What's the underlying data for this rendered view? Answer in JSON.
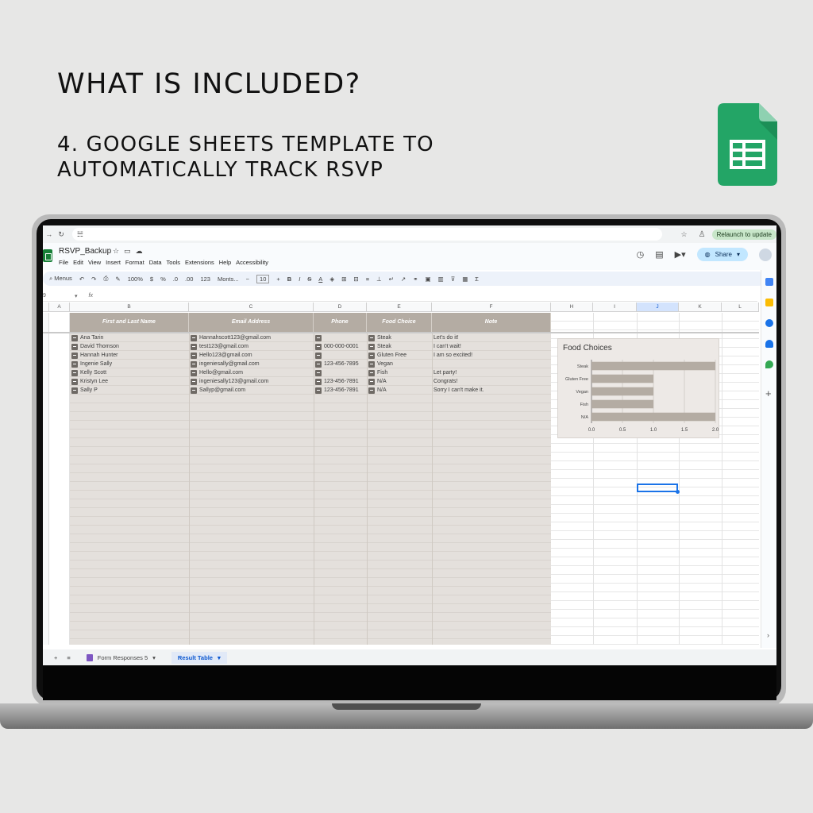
{
  "marketing": {
    "headline": "WHAT IS INCLUDED?",
    "subline1": "4. GOOGLE SHEETS TEMPLATE TO",
    "subline2": "AUTOMATICALLY TRACK RSVP"
  },
  "browser": {
    "url": "☵",
    "relaunch_label": "Relaunch to update"
  },
  "doc": {
    "title": "RSVP_Backup",
    "menus": [
      "File",
      "Edit",
      "View",
      "Insert",
      "Format",
      "Data",
      "Tools",
      "Extensions",
      "Help",
      "Accessibility"
    ],
    "share_label": "Share"
  },
  "toolbar": {
    "search": "Menus",
    "zoom": "100%",
    "currency": "$",
    "percent": "%",
    "dec_down": ".0",
    "dec_up": ".00",
    "number_format": "123",
    "font": "Monts...",
    "font_size": "10"
  },
  "formula_bar": {
    "name_box": "9",
    "fx": "fx"
  },
  "columns": [
    "A",
    "B",
    "C",
    "D",
    "E",
    "F",
    "H",
    "I",
    "J",
    "K",
    "L"
  ],
  "table": {
    "headers": [
      "First and Last Name",
      "Email Address",
      "Phone",
      "Food Choice",
      "Note"
    ],
    "rows": [
      [
        "Ana Tarin",
        "Hannahscott123@gmail.com",
        "",
        "Steak",
        "Let's do it!"
      ],
      [
        "David Thomson",
        "test123@gmail.com",
        "000-000-0001",
        "Steak",
        "I can't wait!"
      ],
      [
        "Hannah Hunter",
        "Hello123@gmail.com",
        "",
        "Gluten Free",
        "I am so excited!"
      ],
      [
        "Ingenie Sally",
        "ingeniesally@gmail.com",
        "123-456-7895",
        "Vegan",
        ""
      ],
      [
        "Kelly Scott",
        "Hello@gmail.com",
        "",
        "Fish",
        "Let party!"
      ],
      [
        "Kristyn Lee",
        "ingeniesally123@gmail.com",
        "123-456-7891",
        "N/A",
        "Congrats!"
      ],
      [
        "Sally P",
        "Sallyp@gmail.com",
        "123-456-7891",
        "N/A",
        "Sorry I can't make it."
      ]
    ]
  },
  "chart_data": {
    "type": "bar",
    "orientation": "horizontal",
    "title": "Food Choices",
    "categories": [
      "Steak",
      "Gluten Free",
      "Vegan",
      "Fish",
      "N/A"
    ],
    "values": [
      2,
      1,
      1,
      1,
      2
    ],
    "xlim": [
      0,
      2
    ],
    "xticks": [
      "0.0",
      "0.5",
      "1.0",
      "1.5",
      "2.0"
    ],
    "bar_color": "#b4aca3",
    "grid": true
  },
  "sheet_tabs": [
    {
      "label": "Form Responses 5",
      "active": false
    },
    {
      "label": "Result Table",
      "active": true
    }
  ],
  "colors": {
    "header_band": "#b4aca3",
    "sheets_green": "#188038"
  }
}
